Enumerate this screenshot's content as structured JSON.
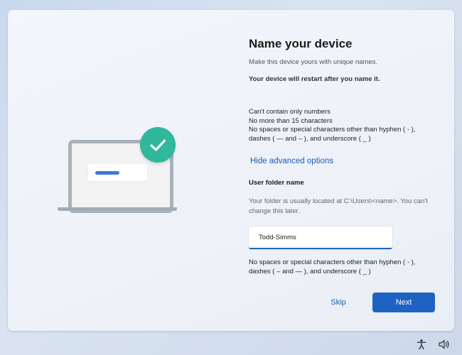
{
  "screen": {
    "title": "Name your device",
    "subtitle": "Make this device yours with unique names.",
    "restart_note": "Your device will restart after you name it.",
    "name_rules": [
      "Can't contain only numbers",
      "No more than 15 characters",
      "No spaces or special characters other than hyphen ( - ),",
      "dashes ( — and – ), and underscore ( _ )"
    ],
    "advanced_link": "Hide advanced options",
    "folder": {
      "label": "User folder name",
      "description": "Your folder is usually located at C:\\Users\\<name>. You can't change this later.",
      "value": "Todd-Simms",
      "rules": [
        "No spaces or special characters other than hyphen ( - ),",
        "dashes ( – and — ), and underscore ( _ )"
      ]
    },
    "buttons": {
      "skip": "Skip",
      "next": "Next"
    }
  },
  "taskbar": {
    "icons": [
      "accessibility-icon",
      "volume-icon"
    ]
  },
  "colors": {
    "accent": "#1d63c4",
    "link": "#1a5ab8",
    "badge": "#31b79c"
  }
}
